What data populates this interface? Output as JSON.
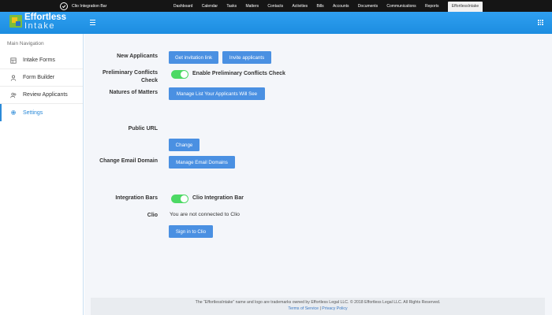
{
  "clio_bar": {
    "brand": "Clio Integration Bar",
    "nav": [
      "Dashboard",
      "Calendar",
      "Tasks",
      "Matters",
      "Contacts",
      "Activities",
      "Bills",
      "Accounts",
      "Documents",
      "Communications",
      "Reports"
    ],
    "active_tab": "EffortlessIntake"
  },
  "header": {
    "logo_word_1": "Effortless",
    "logo_word_2": "Intake"
  },
  "sidebar": {
    "heading": "Main Navigation",
    "items": [
      {
        "label": "Intake Forms",
        "icon": "form-icon"
      },
      {
        "label": "Form Builder",
        "icon": "builder-icon"
      },
      {
        "label": "Review Applicants",
        "icon": "users-icon"
      },
      {
        "label": "Settings",
        "icon": "gear-icon",
        "active": true
      }
    ]
  },
  "settings": {
    "new_applicants_label": "New Applicants",
    "get_invitation_link": "Get invitation link",
    "invite_applicants": "Invite applicants",
    "preliminary_conflicts_label_1": "Preliminary Conflicts",
    "preliminary_conflicts_label_2": "Check",
    "preliminary_conflicts_toggle_label": "Enable Preliminary Conflicts Check",
    "preliminary_conflicts_enabled": true,
    "natures_of_matters_label": "Natures of Matters",
    "manage_list_button": "Manage List Your Applicants Will See",
    "public_url_label": "Public URL",
    "change_button": "Change",
    "change_email_domain_label": "Change Email Domain",
    "manage_email_domains_button": "Manage Email Domains",
    "integration_bars_label": "Integration Bars",
    "clio_integration_bar_toggle_label": "Clio Integration Bar",
    "clio_integration_bar_enabled": true,
    "clio_label": "Clio",
    "clio_status": "You are not connected to Clio",
    "sign_in_button": "Sign in to Clio"
  },
  "footer": {
    "trademark": "The “EffortlessIntake” name and logo are trademarks owned by Effortless Legal LLC. © 2018 Effortless Legal LLC. All Rights Reserved.",
    "terms": "Terms of Service",
    "separator": "|",
    "privacy": "Privacy Policy"
  },
  "colors": {
    "header_blue": "#1c8de0",
    "button_blue": "#4a90e2",
    "toggle_green": "#4cd964",
    "active_nav": "#2b8ad8"
  }
}
